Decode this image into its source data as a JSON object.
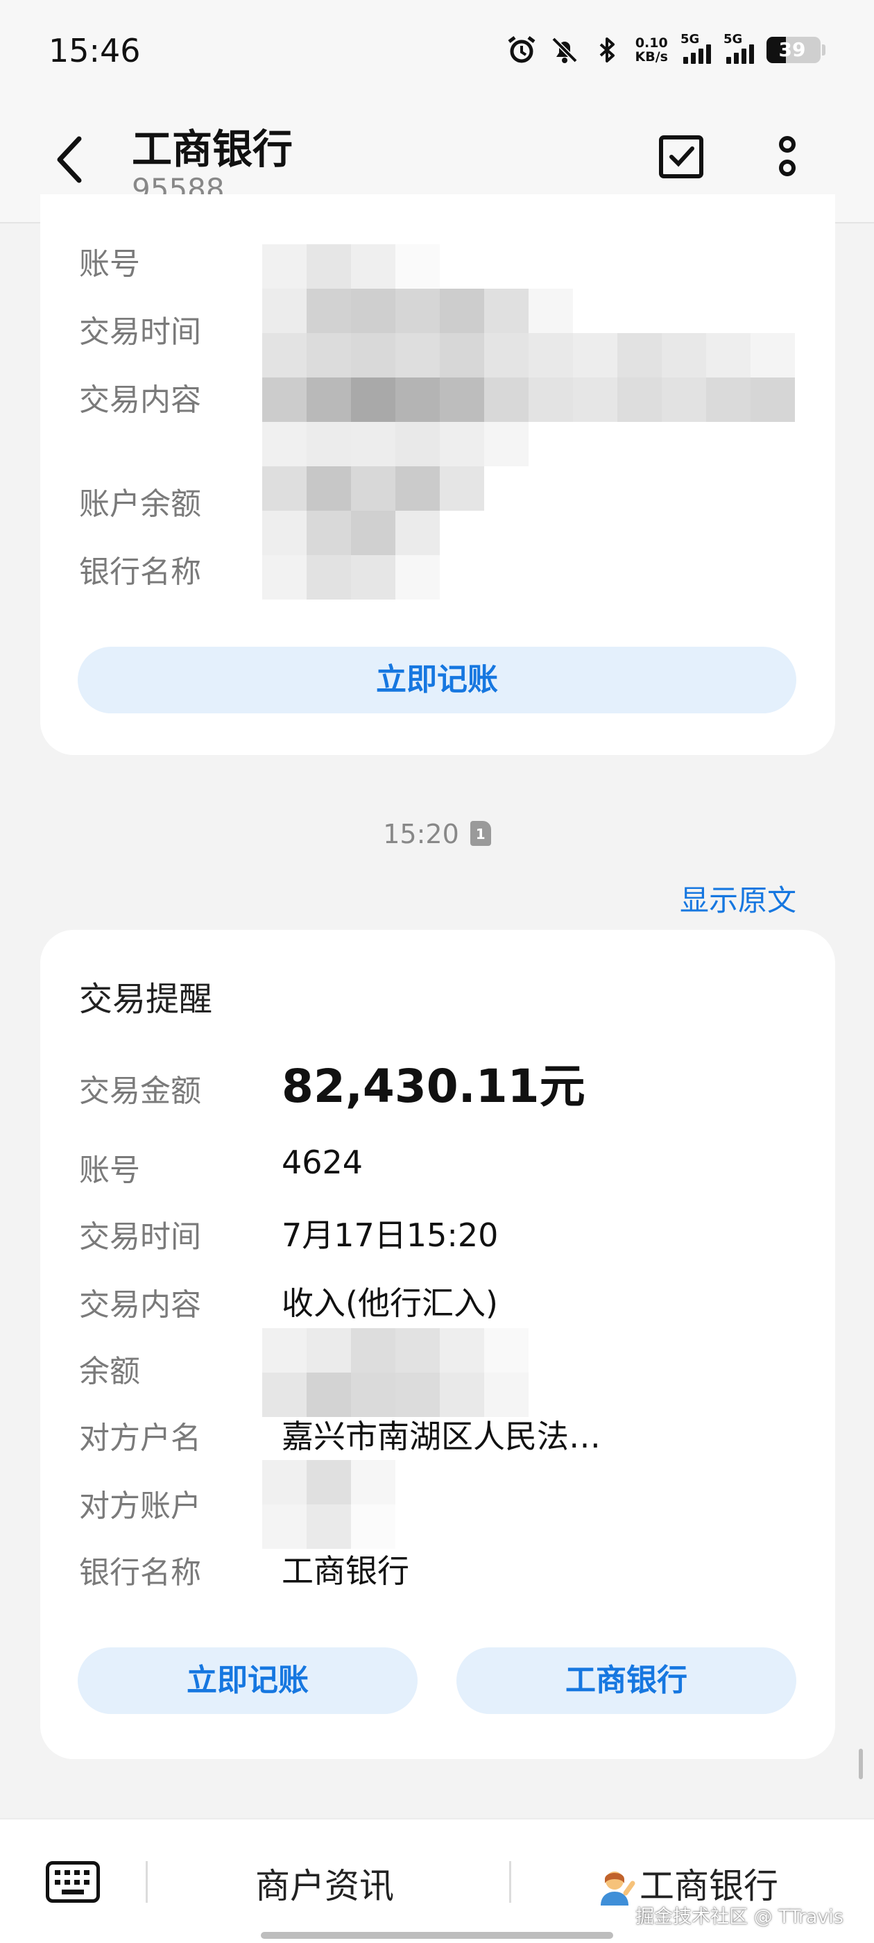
{
  "status_bar": {
    "time": "15:46",
    "net_speed_value": "0.10",
    "net_speed_unit": "KB/s",
    "signal1_tag": "5G",
    "signal2_tag": "5G",
    "battery": "39",
    "icons": [
      "alarm-icon",
      "bell-muted-icon",
      "bluetooth-icon"
    ]
  },
  "header": {
    "title": "工商银行",
    "subtitle": "95588",
    "icons": [
      "back-icon",
      "checkbox-icon",
      "more-vertical-icon"
    ]
  },
  "card1": {
    "rows": [
      {
        "label": "账号"
      },
      {
        "label": "交易时间"
      },
      {
        "label": "交易内容"
      },
      {
        "label": "账户余额"
      },
      {
        "label": "银行名称"
      }
    ],
    "button": "立即记账"
  },
  "timestamp": "15:20",
  "sim_badge": "1",
  "show_original": "显示原文",
  "card2": {
    "title": "交易提醒",
    "rows": [
      {
        "label": "交易金额",
        "value": "82,430.11元"
      },
      {
        "label": "账号",
        "value": "4624"
      },
      {
        "label": "交易时间",
        "value": "7月17日15:20"
      },
      {
        "label": "交易内容",
        "value": "收入(他行汇入)"
      },
      {
        "label": "余额",
        "value": ""
      },
      {
        "label": "对方户名",
        "value": "嘉兴市南湖区人民法…"
      },
      {
        "label": "对方账户",
        "value": ""
      },
      {
        "label": "银行名称",
        "value": "工商银行"
      }
    ],
    "button_left": "立即记账",
    "button_right": "工商银行"
  },
  "bottom_bar": {
    "item1": "商户资讯",
    "item2": "工商银行",
    "watermark": "掘金技术社区 @ TTravis"
  },
  "colors": {
    "accent": "#1677e0",
    "pill_bg": "#e4f0fc",
    "page_bg": "#f3f3f3"
  }
}
